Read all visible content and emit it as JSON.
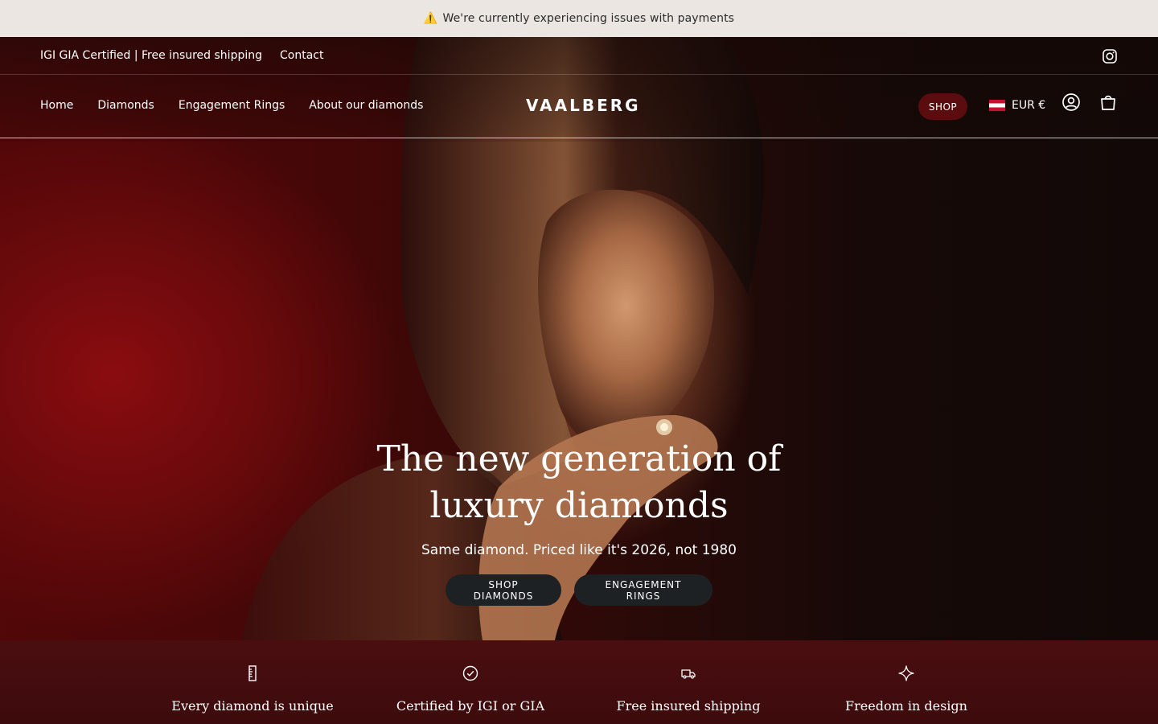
{
  "announcement": {
    "icon": "warning-icon",
    "text": "We're currently experiencing issues with payments",
    "glyph": "⚠️"
  },
  "utility": {
    "certified_text": "IGI GIA Certified | Free insured shipping",
    "contact": "Contact",
    "social_icon": "instagram-icon"
  },
  "nav": {
    "items": [
      {
        "label": "Home"
      },
      {
        "label": "Diamonds"
      },
      {
        "label": "Engagement Rings"
      },
      {
        "label": "About our diamonds"
      }
    ],
    "logo": "VAALBERG",
    "shop_label": "SHOP",
    "currency": "EUR €",
    "account_icon": "account-icon",
    "cart_icon": "cart-icon"
  },
  "hero": {
    "title": "The new generation of luxury diamonds",
    "subtitle": "Same diamond. Priced like it's 2026, not 1980",
    "buttons": [
      {
        "label": "SHOP DIAMONDS"
      },
      {
        "label": "ENGAGEMENT RINGS"
      }
    ]
  },
  "features": [
    {
      "icon": "ruler-icon",
      "label": "Every diamond is unique"
    },
    {
      "icon": "check-circle-icon",
      "label": "Certified by IGI or GIA"
    },
    {
      "icon": "truck-icon",
      "label": "Free insured shipping"
    },
    {
      "icon": "sparkle-icon",
      "label": "Freedom in design"
    }
  ],
  "colors": {
    "announcement_bg": "#ebe6e1",
    "shop_button": "#5b0c0e",
    "feature_bar": "#420c0e",
    "hero_button": "#1e2123"
  }
}
